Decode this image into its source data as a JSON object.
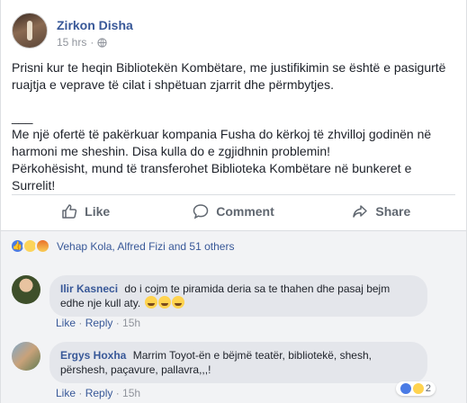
{
  "post": {
    "author": "Zirkon Disha",
    "time": "15 hrs",
    "more_label": "•••",
    "paragraphs": [
      "Prisni kur te heqin Bibliotekën Kombëtare, me justifikimin se është e pasigurtë ruajtja e veprave të cilat i shpëtuan zjarrit dhe përmbytjes.",
      "___",
      "Me një ofertë të pakërkuar kompania Fusha do kërkoj të zhvilloj godinën në harmoni me sheshin. Disa kulla do e zgjidhnin problemin!",
      "Përkohësisht, mund të transferohet Biblioteka Kombëtare në bunkeret e Surrelit!"
    ]
  },
  "actions": {
    "like": "Like",
    "comment": "Comment",
    "share": "Share"
  },
  "reactions": {
    "summary": "Vehap Kola, Alfred Fizi and 51 others",
    "types": [
      "like",
      "sad",
      "angry"
    ]
  },
  "comments": [
    {
      "author": "Ilir Kasneci",
      "text": "do i cojm te piramida deria sa te thahen dhe pasaj bejm edhe nje kull aty.",
      "emoji_count": 3,
      "like": "Like",
      "reply": "Reply",
      "time": "15h"
    },
    {
      "author": "Ergys Hoxha",
      "text": "Marrim Toyot-ën e bëjmë teatër, bibliotekë, shesh, përshesh, paçavure, pallavra,,,!",
      "like": "Like",
      "reply": "Reply",
      "time": "15h",
      "reaction_count": "2"
    }
  ],
  "colors": {
    "link": "#385898",
    "meta": "#90949c",
    "bubble": "#e4e6eb"
  },
  "icons": [
    "globe-icon",
    "like-icon",
    "comment-icon",
    "share-icon"
  ]
}
